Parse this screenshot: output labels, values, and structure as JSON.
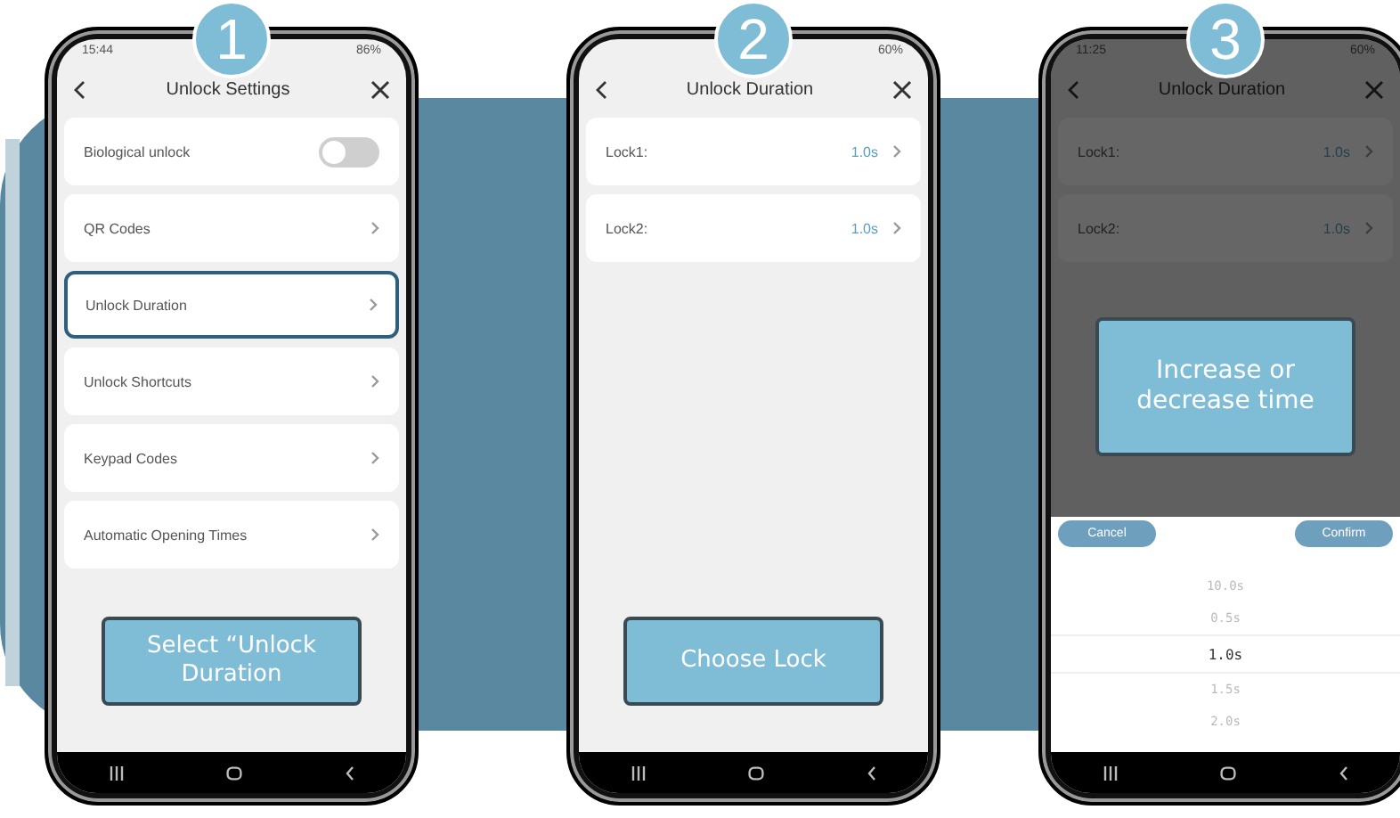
{
  "steps": [
    {
      "number": "1",
      "screen": {
        "time": "15:44",
        "battery": "86%",
        "title": "Unlock Settings",
        "items": [
          {
            "kind": "toggle",
            "label": "Biological unlock",
            "on": false,
            "selected": false
          },
          {
            "kind": "link",
            "label": "QR Codes",
            "selected": false
          },
          {
            "kind": "link",
            "label": "Unlock Duration",
            "selected": true
          },
          {
            "kind": "link",
            "label": "Unlock Shortcuts",
            "selected": false
          },
          {
            "kind": "link",
            "label": "Keypad Codes",
            "selected": false
          },
          {
            "kind": "link",
            "label": "Automatic Opening Times",
            "selected": false
          }
        ]
      },
      "callout": {
        "text": "Select “Unlock Duration"
      }
    },
    {
      "number": "2",
      "screen": {
        "battery": "60%",
        "title": "Unlock Duration",
        "items": [
          {
            "kind": "value",
            "label": "Lock1:",
            "value": "1.0s",
            "selected": false
          },
          {
            "kind": "value",
            "label": "Lock2:",
            "value": "1.0s",
            "selected": false
          }
        ]
      },
      "callout": {
        "text": "Choose Lock"
      }
    },
    {
      "number": "3",
      "screen": {
        "time": "11:25",
        "battery": "60%",
        "title": "Unlock Duration",
        "items": [
          {
            "kind": "value",
            "label": "Lock1:",
            "value": "1.0s",
            "selected": false
          },
          {
            "kind": "value",
            "label": "Lock2:",
            "value": "1.0s",
            "selected": false
          }
        ],
        "picker": {
          "cancel": "Cancel",
          "confirm": "Confirm",
          "options": [
            {
              "label": "10.0s",
              "selected": false
            },
            {
              "label": "0.5s",
              "selected": false
            },
            {
              "label": "1.0s",
              "selected": true
            },
            {
              "label": "1.5s",
              "selected": false
            },
            {
              "label": "2.0s",
              "selected": false
            }
          ]
        }
      },
      "callout": {
        "text": "Increase or decrease time"
      }
    }
  ]
}
